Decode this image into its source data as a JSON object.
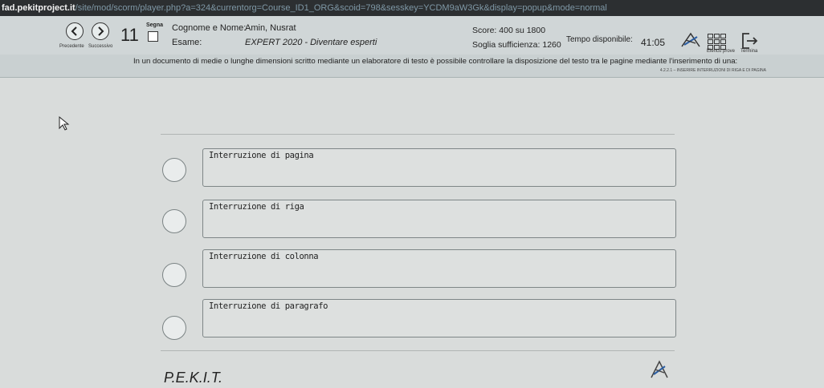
{
  "browser": {
    "host": "fad.pekitproject.it",
    "path": "/site/mod/scorm/player.php?a=324&currentorg=Course_ID1_ORG&scoid=798&sesskey=YCDM9aW3Gk&display=popup&mode=normal"
  },
  "toolbar": {
    "prev_label": "Precedente",
    "next_label": "Successivo",
    "question_number": "11",
    "mark_label": "Segna",
    "name_label": "Cognome e Nome:",
    "name_value": "Amin, Nusrat",
    "exam_label": "Esame:",
    "exam_value": "EXPERT 2020 - Diventare esperti",
    "score": "Score: 400 su 1800",
    "threshold": "Soglia sufficienza: 1260",
    "time_label": "Tempo disponibile:",
    "time_value": "41:05",
    "list_label": "Elenco prove",
    "end_label": "Termina"
  },
  "question": {
    "text": "In un documento di medie o lunghe dimensioni scritto mediante un elaboratore di testo è possibile controllare la disposizione del testo tra le pagine mediante l'inserimento di una:",
    "reference": "4.2.2.1 – INSERIRE INTERRUZIONI DI RIGA E DI PAGINA"
  },
  "options": [
    {
      "label": "Interruzione di pagina"
    },
    {
      "label": "Interruzione di riga"
    },
    {
      "label": "Interruzione di colonna"
    },
    {
      "label": "Interruzione di paragrafo"
    }
  ],
  "footer": {
    "logo": "P.E.K.I.T."
  }
}
